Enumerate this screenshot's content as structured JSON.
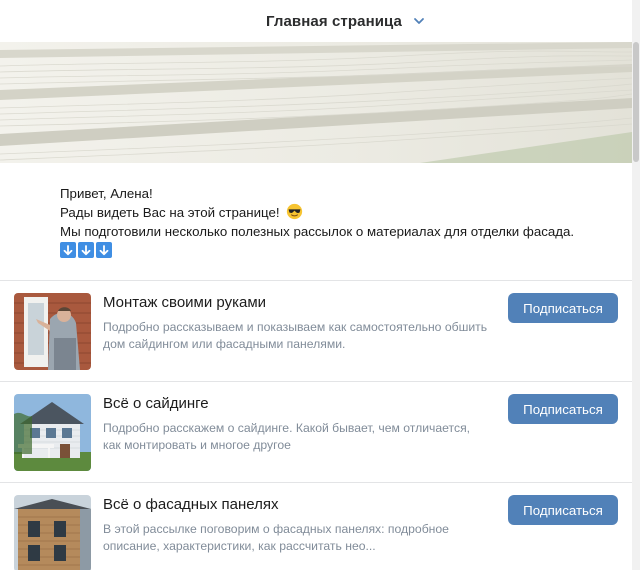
{
  "header": {
    "title": "Главная страница",
    "dropdown_icon": "chevron-down-icon"
  },
  "banner": {
    "description_icon": "siding-wood-texture-image"
  },
  "greeting": {
    "line1": "Привет, Алена!",
    "line2": "Рады видеть Вас на этой странице!",
    "line2_emoji": "smiling-face-with-sunglasses-icon",
    "line3": "Мы подготовили несколько полезных рассылок о материалах для отделки фасада.",
    "arrow_icons": [
      "down-arrow-icon",
      "down-arrow-icon",
      "down-arrow-icon"
    ]
  },
  "subscriptions": [
    {
      "title": "Монтаж своими руками",
      "description": "Подробно рассказываем и показываем как самостоятельно обшить дом сайдингом или фасадными панелями.",
      "button": "Подписаться"
    },
    {
      "title": "Всё о сайдинге",
      "description": "Подробно расскажем о сайдинге. Какой бывает, чем отличается, как монтировать и многое другое",
      "button": "Подписаться"
    },
    {
      "title": "Всё о фасадных панелях",
      "description": "В этой рассылке поговорим о фасадных панелях: подробное описание, характеристики, как рассчитать нео...",
      "button": "Подписаться"
    }
  ],
  "colors": {
    "button_bg": "#5181b8",
    "muted_text": "#818c99",
    "arrow_emoji_bg": "#3f8ee3"
  }
}
